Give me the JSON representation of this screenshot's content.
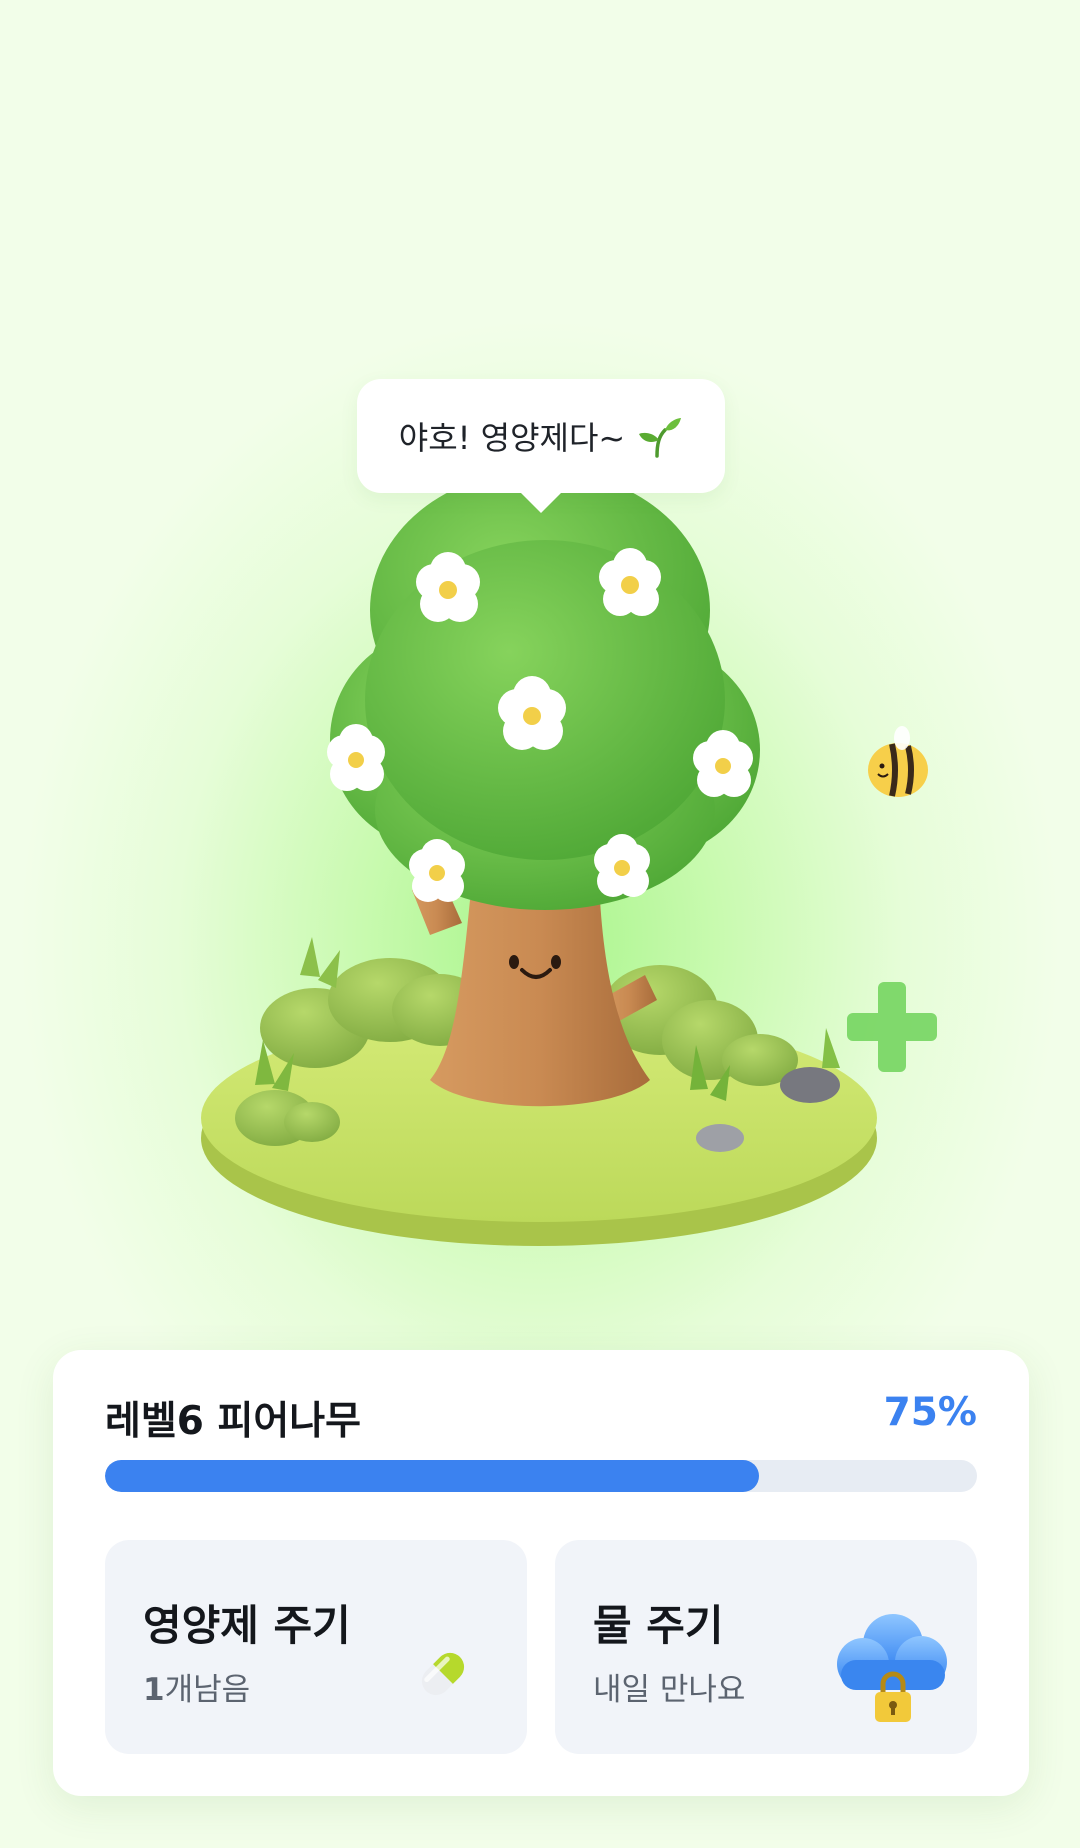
{
  "bubble": {
    "text": "야호! 영양제다~",
    "icon": "sprout-icon"
  },
  "status": {
    "title": "레벨6 피어나무",
    "percent_label": "75%",
    "progress": 0.75
  },
  "actions": [
    {
      "title": "영양제 주기",
      "sub_count": "1",
      "sub_text": "개남음",
      "icon": "pill-icon"
    },
    {
      "title": "물 주기",
      "sub_text": "내일 만나요",
      "icon": "locked-cloud-icon"
    }
  ],
  "colors": {
    "accent": "#3b82f0",
    "track": "#e7ecf3",
    "leaf": "#6cc04a",
    "trunk": "#c98a52",
    "ground": "#c9e06b"
  }
}
